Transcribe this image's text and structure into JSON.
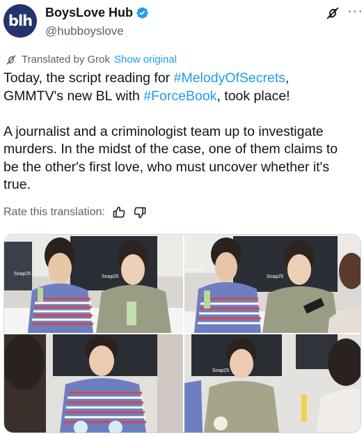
{
  "account": {
    "avatar_text": "blh",
    "display_name": "BoysLove Hub",
    "handle": "@hubboyslove",
    "verified": true,
    "avatar_color": "#23346a"
  },
  "actions": {
    "grok_icon": "grok-icon",
    "more_label": "···"
  },
  "translation": {
    "label": "Translated by Grok",
    "show_original": "Show original"
  },
  "tweet": {
    "line1_a": "Today, the script reading for ",
    "hashtag1": "#MelodyOfSecrets",
    "line1_b": ",",
    "line2_a": "GMMTV's new BL with ",
    "hashtag2": "#ForceBook",
    "line2_b": ", took place!",
    "paragraph2": "A journalist and a criminologist team up to investigate murders. In the midst of the case, one of them claims to be the other's first love, who must uncover whether it's true."
  },
  "rate": {
    "label": "Rate this translation:"
  },
  "colors": {
    "link": "#1d9bf0",
    "secondary_text": "#536471",
    "verified": "#1d9bf0"
  },
  "media": {
    "count": 4,
    "poster_text": "Snap25"
  }
}
